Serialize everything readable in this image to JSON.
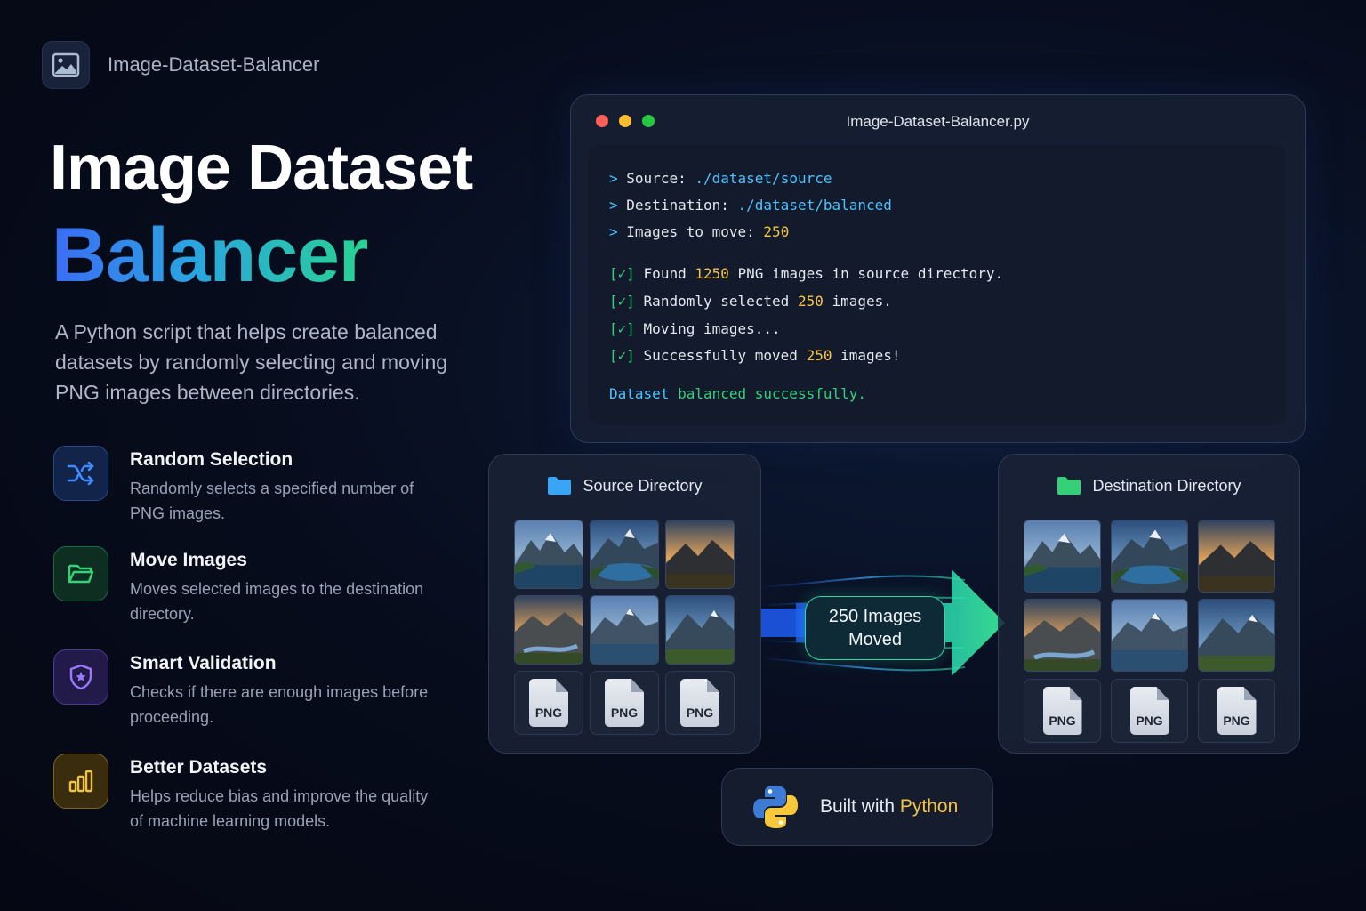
{
  "brand": {
    "name": "Image-Dataset-Balancer",
    "icon": "image-icon"
  },
  "hero": {
    "title_line1": "Image Dataset",
    "title_line2": "Balancer",
    "description": "A Python script that helps create balanced datasets by randomly selecting and moving PNG images between directories."
  },
  "features": [
    {
      "title": "Random Selection",
      "desc": "Randomly selects a specified number of PNG images.",
      "icon": "shuffle-icon",
      "color": "#2f7cf6"
    },
    {
      "title": "Move Images",
      "desc": "Moves selected images to the destination directory.",
      "icon": "folder-open-icon",
      "color": "#2fc766"
    },
    {
      "title": "Smart Validation",
      "desc": "Checks if there are enough images before proceeding.",
      "icon": "shield-check-icon",
      "color": "#8a63f2"
    },
    {
      "title": "Better Datasets",
      "desc": "Helps reduce bias and improve the quality of machine learning models.",
      "icon": "bar-chart-icon",
      "color": "#e3b53a"
    }
  ],
  "terminal": {
    "title": "Image-Dataset-Balancer.py",
    "prompt": ">",
    "source_label": "Source:",
    "source_value": "./dataset/source",
    "dest_label": "Destination:",
    "dest_value": "./dataset/balanced",
    "move_label": "Images to move:",
    "move_value": "250",
    "check": "[✓]",
    "found_pre": "Found",
    "found_num": "1250",
    "found_post": "PNG images in source directory.",
    "selected_pre": "Randomly selected",
    "selected_num": "250",
    "selected_post": "images.",
    "moving": "Moving images...",
    "moved_pre": "Successfully moved",
    "moved_num": "250",
    "moved_post": "images!",
    "final_w1": "Dataset",
    "final_w2": "balanced successfully."
  },
  "source_dir": {
    "title": "Source Directory",
    "png_label": "PNG"
  },
  "dest_dir": {
    "title": "Destination Directory",
    "png_label": "PNG"
  },
  "moved_badge": {
    "line1": "250 Images",
    "line2": "Moved"
  },
  "built": {
    "prefix": "Built with",
    "highlight": "Python",
    "icon": "python-logo-icon"
  }
}
